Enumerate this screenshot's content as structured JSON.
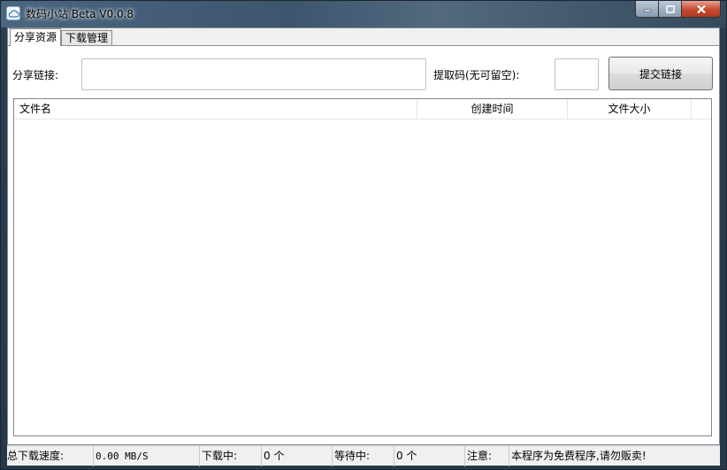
{
  "window": {
    "title": "数码小站 Beta V0.0.8",
    "icon": "cloud-icon",
    "controls": {
      "minimize": "minimize-icon",
      "maximize": "maximize-icon",
      "close": "close-icon"
    }
  },
  "tabs": [
    {
      "label": "分享资源",
      "active": true
    },
    {
      "label": "下载管理",
      "active": false
    }
  ],
  "share_form": {
    "link_label": "分享链接:",
    "link_value": "",
    "code_label": "提取码(无可留空):",
    "code_value": "",
    "submit_label": "提交链接"
  },
  "file_list": {
    "columns": [
      "文件名",
      "创建时间",
      "文件大小"
    ],
    "rows": []
  },
  "statusbar": {
    "speed_label": "总下载速度:",
    "speed_value": "0.00 MB/S",
    "downloading_label": "下载中:",
    "downloading_value": "0 个",
    "waiting_label": "等待中:",
    "waiting_value": "0 个",
    "note_label": "注意:",
    "note_value": "本程序为免费程序,请勿贩卖!"
  }
}
